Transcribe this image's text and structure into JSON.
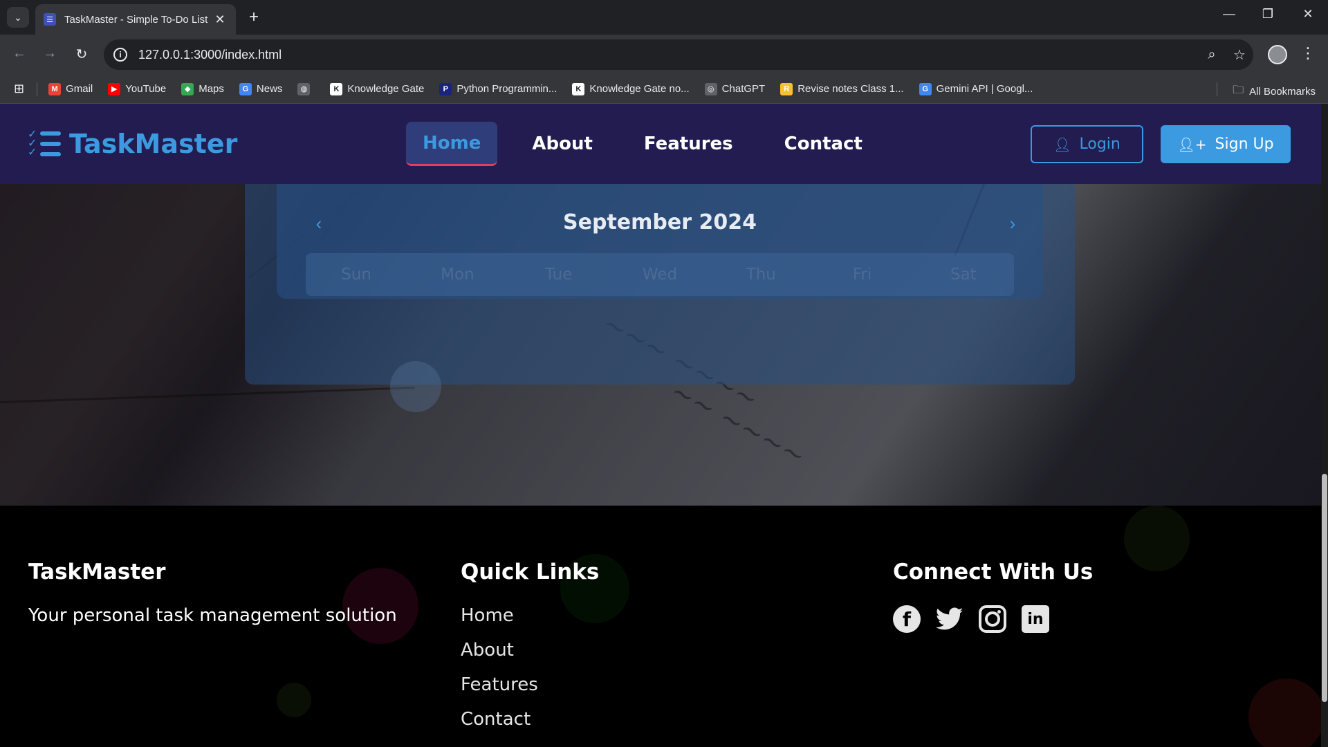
{
  "browser": {
    "tab_title": "TaskMaster - Simple To-Do List",
    "url": "127.0.0.1:3000/index.html",
    "bookmarks": [
      {
        "label": "Gmail",
        "color": "#ea4335",
        "glyph": "M"
      },
      {
        "label": "YouTube",
        "color": "#ff0000",
        "glyph": "▶"
      },
      {
        "label": "Maps",
        "color": "#34a853",
        "glyph": "◆"
      },
      {
        "label": "News",
        "color": "#4285f4",
        "glyph": "G"
      },
      {
        "label": "",
        "color": "#5f6368",
        "glyph": "◍"
      },
      {
        "label": "Knowledge Gate",
        "color": "#ffffff",
        "glyph": "K"
      },
      {
        "label": "Python Programmin...",
        "color": "#1a237e",
        "glyph": "P"
      },
      {
        "label": "Knowledge Gate no...",
        "color": "#ffffff",
        "glyph": "K"
      },
      {
        "label": "ChatGPT",
        "color": "#5f6368",
        "glyph": "◎"
      },
      {
        "label": "Revise notes Class 1...",
        "color": "#fbc02d",
        "glyph": "R"
      },
      {
        "label": "Gemini API | Googl...",
        "color": "#4285f4",
        "glyph": "G"
      }
    ],
    "all_bookmarks": "All Bookmarks"
  },
  "navbar": {
    "brand": "TaskMaster",
    "menu": [
      "Home",
      "About",
      "Features",
      "Contact"
    ],
    "active": "Home",
    "login_label": "Login",
    "signup_label": "Sign Up",
    "accent": "#3b9ae0"
  },
  "calendar": {
    "month_title": "September 2024",
    "weekdays": [
      "Sun",
      "Mon",
      "Tue",
      "Wed",
      "Thu",
      "Fri",
      "Sat"
    ]
  },
  "footer": {
    "brand": "TaskMaster",
    "tagline": "Your personal task management solution",
    "quick_links_title": "Quick Links",
    "quick_links": [
      "Home",
      "About",
      "Features",
      "Contact"
    ],
    "connect_title": "Connect With Us",
    "social": [
      "facebook-icon",
      "twitter-icon",
      "instagram-icon",
      "linkedin-icon"
    ]
  }
}
